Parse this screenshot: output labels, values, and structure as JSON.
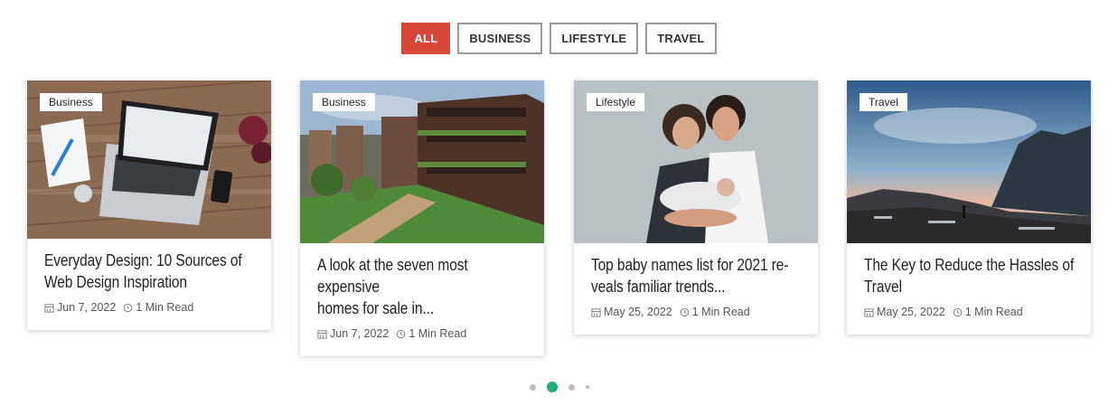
{
  "filters": [
    {
      "label": "ALL",
      "active": true
    },
    {
      "label": "BUSINESS",
      "active": false
    },
    {
      "label": "LIFESTYLE",
      "active": false
    },
    {
      "label": "TRAVEL",
      "active": false
    }
  ],
  "cards": [
    {
      "category": "Business",
      "title_line1": "Everyday Design: 10 Sources of",
      "title_line2": "Web Design Inspiration",
      "date": "Jun 7, 2022",
      "read": "1 Min Read"
    },
    {
      "category": "Business",
      "title_line1": "A look at the seven most expensive",
      "title_line2": "homes for sale in...",
      "date": "Jun 7, 2022",
      "read": "1 Min Read"
    },
    {
      "category": "Lifestyle",
      "title_line1": "Top baby names list for 2021 re-",
      "title_line2": "veals familiar trends...",
      "date": "May 25, 2022",
      "read": "1 Min Read"
    },
    {
      "category": "Travel",
      "title_line1": "The Key to Reduce the Hassles of",
      "title_line2": "Travel",
      "date": "May 25, 2022",
      "read": "1 Min Read"
    }
  ],
  "pagination": {
    "count": 4,
    "active_index": 1,
    "active_color": "#1fae7a"
  },
  "colors": {
    "accent": "#d9473a"
  }
}
